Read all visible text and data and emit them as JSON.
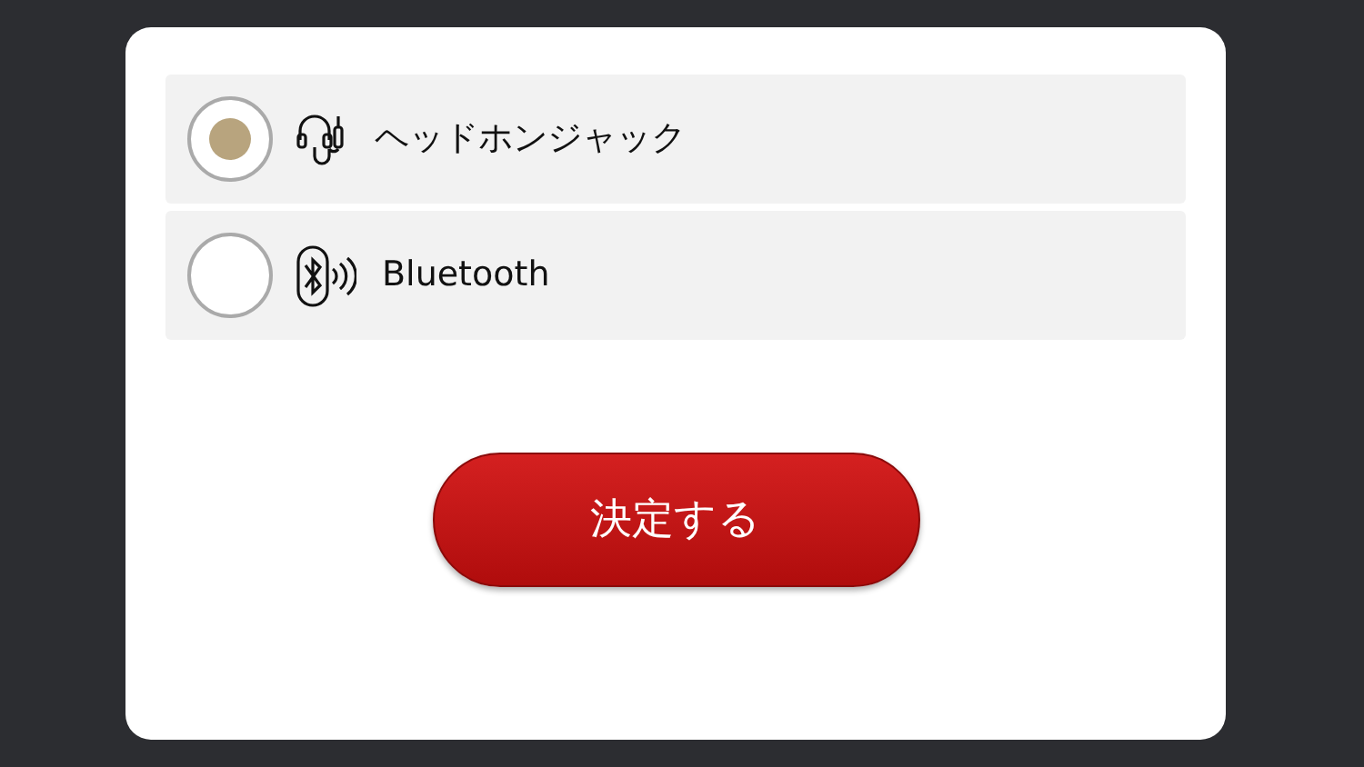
{
  "options": [
    {
      "kind": "headphone",
      "label": "ヘッドホンジャック",
      "selected": true
    },
    {
      "kind": "bluetooth",
      "label": "Bluetooth",
      "selected": false
    }
  ],
  "confirm_button": "決定する"
}
